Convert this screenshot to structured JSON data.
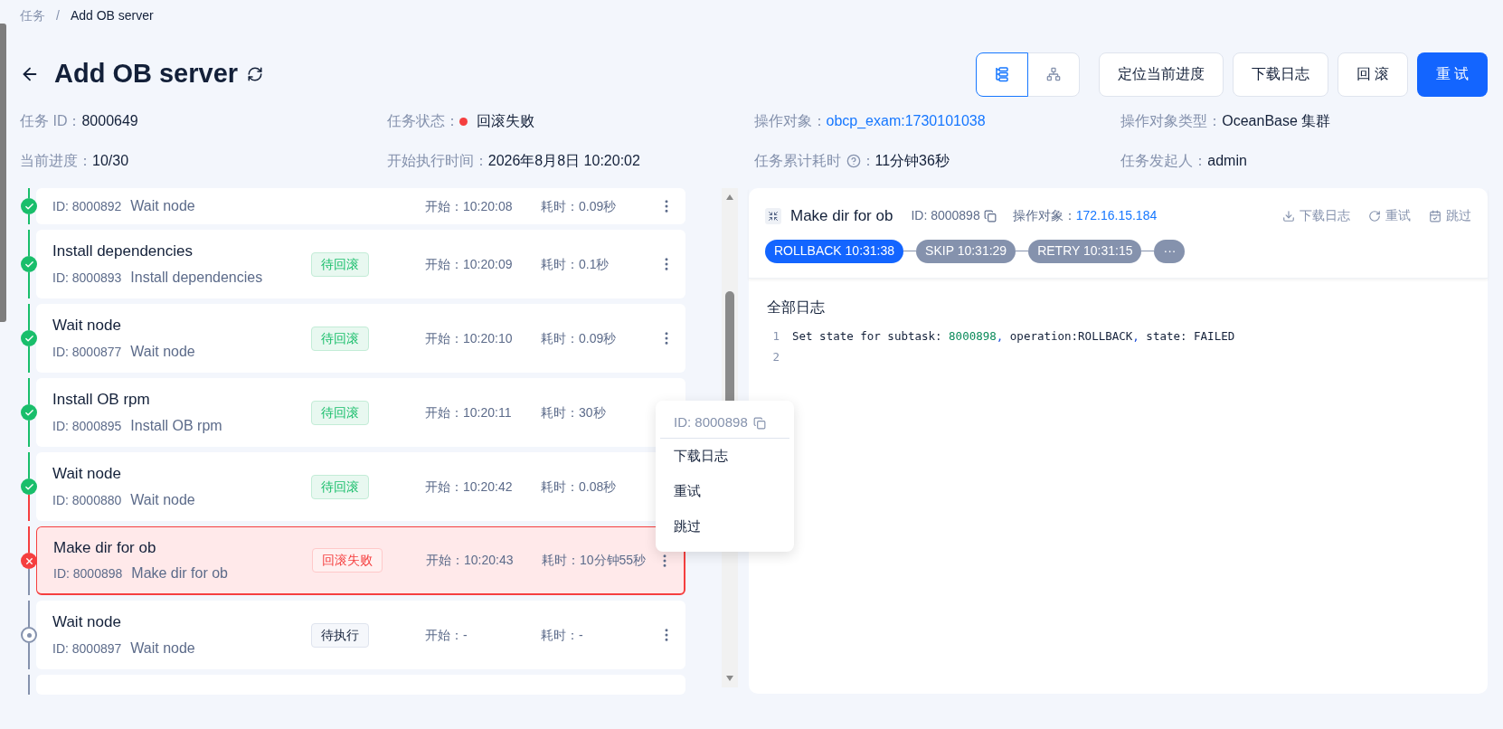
{
  "breadcrumb": {
    "separator": "/",
    "items": [
      {
        "label": "任务"
      },
      {
        "label": "Add OB server"
      }
    ]
  },
  "header": {
    "title": "Add OB server",
    "view_toggle": [
      {
        "kind": "list",
        "selected": true
      },
      {
        "kind": "graph",
        "selected": false
      }
    ],
    "buttons": [
      {
        "label": "定位当前进度",
        "kind": "default"
      },
      {
        "label": "下载日志",
        "kind": "default"
      },
      {
        "label": "回 滚",
        "kind": "default"
      },
      {
        "label": "重 试",
        "kind": "primary"
      }
    ]
  },
  "info": [
    {
      "label": "任务 ID：",
      "value": "8000649",
      "kind": "text"
    },
    {
      "label": "任务状态：",
      "value": "回滚失败",
      "kind": "status",
      "color": "#f53f3f"
    },
    {
      "label": "操作对象：",
      "value": "obcp_exam:1730101038",
      "kind": "link"
    },
    {
      "label": "操作对象类型：",
      "value": "OceanBase 集群",
      "kind": "text"
    },
    {
      "label": "当前进度：",
      "value": "10/30",
      "kind": "text"
    },
    {
      "label": "开始执行时间：",
      "value": "2026年8月8日 10:20:02",
      "kind": "text"
    },
    {
      "label": "任务累计耗时",
      "suffix": "：",
      "value": "11分钟36秒",
      "kind": "help"
    },
    {
      "label": "任务发起人：",
      "value": "admin",
      "kind": "text"
    }
  ],
  "tasks": [
    {
      "kind": "done",
      "id": "ID: 8000892",
      "name": "Wait node",
      "start": "开始：10:20:08",
      "duration": "耗时：0.09秒"
    },
    {
      "kind": "done",
      "title": "Install dependencies",
      "badge": "待回滚",
      "id": "ID: 8000893",
      "name": "Install dependencies",
      "start": "开始：10:20:09",
      "duration": "耗时：0.1秒"
    },
    {
      "kind": "done",
      "title": "Wait node",
      "badge": "待回滚",
      "id": "ID: 8000877",
      "name": "Wait node",
      "start": "开始：10:20:10",
      "duration": "耗时：0.09秒"
    },
    {
      "kind": "done",
      "title": "Install OB rpm",
      "badge": "待回滚",
      "id": "ID: 8000895",
      "name": "Install OB rpm",
      "start": "开始：10:20:11",
      "duration": "耗时：30秒"
    },
    {
      "kind": "done",
      "title": "Wait node",
      "badge": "待回滚",
      "id": "ID: 8000880",
      "name": "Wait node",
      "start": "开始：10:20:42",
      "duration": "耗时：0.08秒"
    },
    {
      "kind": "failed",
      "title": "Make dir for ob",
      "badge": "回滚失败",
      "id": "ID: 8000898",
      "name": "Make dir for ob",
      "start": "开始：10:20:43",
      "duration": "耗时：10分钟55秒"
    },
    {
      "kind": "pending",
      "title": "Wait node",
      "badge": "待执行",
      "id": "ID: 8000897",
      "name": "Wait node",
      "start": "开始：-",
      "duration": "耗时：-"
    },
    {
      "kind": "pending"
    }
  ],
  "menu": {
    "id": "ID: 8000898",
    "items": [
      {
        "label": "下载日志"
      },
      {
        "label": "重试"
      },
      {
        "label": "跳过"
      }
    ]
  },
  "detail": {
    "title": "Make dir for ob",
    "id": "ID: 8000898",
    "target_label": "操作对象：",
    "target": "172.16.15.184",
    "actions": [
      {
        "kind": "download",
        "label": "下载日志"
      },
      {
        "kind": "retry",
        "label": "重试"
      },
      {
        "kind": "skip",
        "label": "跳过"
      }
    ],
    "history": [
      {
        "label": "ROLLBACK 10:31:38",
        "selected": true
      },
      {
        "label": "SKIP 10:31:29",
        "selected": false
      },
      {
        "label": "RETRY 10:31:15",
        "selected": false
      }
    ],
    "more": "···",
    "log_title": "全部日志",
    "log_lines": [
      {
        "number": "1",
        "segments": [
          {
            "kind": "plain",
            "text": "Set state for subtask: "
          },
          {
            "kind": "number",
            "text": "8000898"
          },
          {
            "kind": "punct",
            "text": ","
          },
          {
            "kind": "plain",
            "text": " operation:ROLLBACK"
          },
          {
            "kind": "punct",
            "text": ","
          },
          {
            "kind": "plain",
            "text": " state: FAILED"
          }
        ]
      },
      {
        "number": "2"
      }
    ]
  }
}
